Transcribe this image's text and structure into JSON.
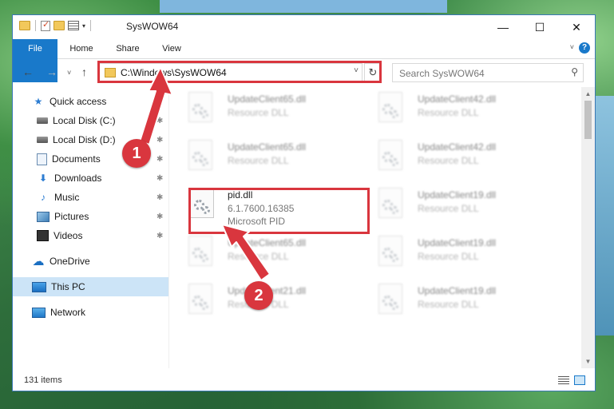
{
  "window": {
    "title": "SysWOW64",
    "minimize_glyph": "—",
    "maximize_glyph": "☐",
    "close_glyph": "✕"
  },
  "ribbon": {
    "tabs": [
      "File",
      "Home",
      "Share",
      "View"
    ],
    "help_glyph": "?",
    "expand_glyph": "˅"
  },
  "navbar": {
    "back_glyph": "←",
    "forward_glyph": "→",
    "recent_glyph": "˅",
    "up_glyph": "↑",
    "address_path": "C:\\Windows\\SysWOW64",
    "address_dropdown_glyph": "˅",
    "refresh_glyph": "↻",
    "search_placeholder": "Search SysWOW64",
    "search_glyph": "⚲"
  },
  "sidebar": {
    "items": [
      {
        "label": "Quick access",
        "icon": "star-icon"
      },
      {
        "label": "Local Disk (C:)",
        "icon": "disk-icon",
        "pinned": true
      },
      {
        "label": "Local Disk (D:)",
        "icon": "disk-icon",
        "pinned": true
      },
      {
        "label": "Documents",
        "icon": "documents-icon",
        "pinned": true
      },
      {
        "label": "Downloads",
        "icon": "download-icon",
        "pinned": true
      },
      {
        "label": "Music",
        "icon": "music-icon",
        "pinned": true
      },
      {
        "label": "Pictures",
        "icon": "pictures-icon",
        "pinned": true
      },
      {
        "label": "Videos",
        "icon": "videos-icon",
        "pinned": true
      },
      {
        "label": "OneDrive",
        "icon": "cloud-icon"
      },
      {
        "label": "This PC",
        "icon": "computer-icon",
        "selected": true
      },
      {
        "label": "Network",
        "icon": "network-icon"
      }
    ],
    "pin_glyph": "📌"
  },
  "files": [
    {
      "name": "UpdateClient65.dll",
      "desc": "Resource DLL"
    },
    {
      "name": "UpdateClient42.dll",
      "desc": "Resource DLL"
    },
    {
      "name": "UpdateClient65.dll",
      "desc": "Resource DLL"
    },
    {
      "name": "UpdateClient42.dll",
      "desc": "Resource DLL"
    },
    {
      "name": "pid.dll",
      "desc": "6.1.7600.16385",
      "desc2": "Microsoft PID",
      "highlight": true
    },
    {
      "name": "UpdateClient19.dll",
      "desc": "Resource DLL"
    },
    {
      "name": "UpdateClient65.dll",
      "desc": "Resource DLL"
    },
    {
      "name": "UpdateClient19.dll",
      "desc": "Resource DLL"
    },
    {
      "name": "UpdateClient21.dll",
      "desc": "Resource DLL"
    },
    {
      "name": "UpdateClient19.dll",
      "desc": "Resource DLL"
    }
  ],
  "status": {
    "item_count": "131 items"
  },
  "callouts": {
    "step1": "1",
    "step2": "2",
    "color": "#d9363e"
  },
  "colors": {
    "accent": "#1979ca",
    "selection": "#cce4f7",
    "highlight": "#d9363e"
  }
}
